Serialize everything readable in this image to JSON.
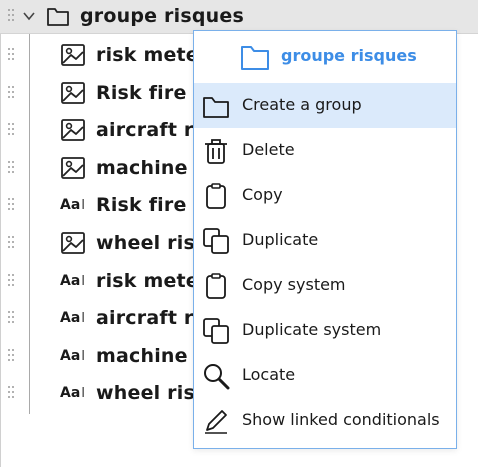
{
  "tree": {
    "group": {
      "label": "groupe risques",
      "expanded": true
    },
    "items": [
      {
        "type": "image",
        "label": "risk meter"
      },
      {
        "type": "image",
        "label": "Risk fire e"
      },
      {
        "type": "image",
        "label": "aircraft ris"
      },
      {
        "type": "image",
        "label": "machine r"
      },
      {
        "type": "text",
        "label": "Risk fire e"
      },
      {
        "type": "image",
        "label": "wheel risk"
      },
      {
        "type": "text",
        "label": "risk meter"
      },
      {
        "type": "text",
        "label": "aircraft ris"
      },
      {
        "type": "text",
        "label": "machine r"
      },
      {
        "type": "text",
        "label": "wheel risk"
      }
    ],
    "text_icon_glyph": "Aa",
    "text_icon_cursor": "I"
  },
  "context_menu": {
    "title": "groupe risques",
    "accent_color": "#3d8de6",
    "highlight_color": "#dbeafb",
    "items": [
      {
        "label": "Create a group",
        "icon": "folder-icon",
        "active": true
      },
      {
        "label": "Delete",
        "icon": "trash-icon"
      },
      {
        "label": "Copy",
        "icon": "clipboard-icon"
      },
      {
        "label": "Duplicate",
        "icon": "duplicate-icon"
      },
      {
        "label": "Copy system",
        "icon": "clipboard-icon"
      },
      {
        "label": "Duplicate system",
        "icon": "duplicate-icon"
      },
      {
        "label": "Locate",
        "icon": "magnifier-icon"
      },
      {
        "label": "Show linked conditionals",
        "icon": "pencil-icon"
      }
    ]
  }
}
